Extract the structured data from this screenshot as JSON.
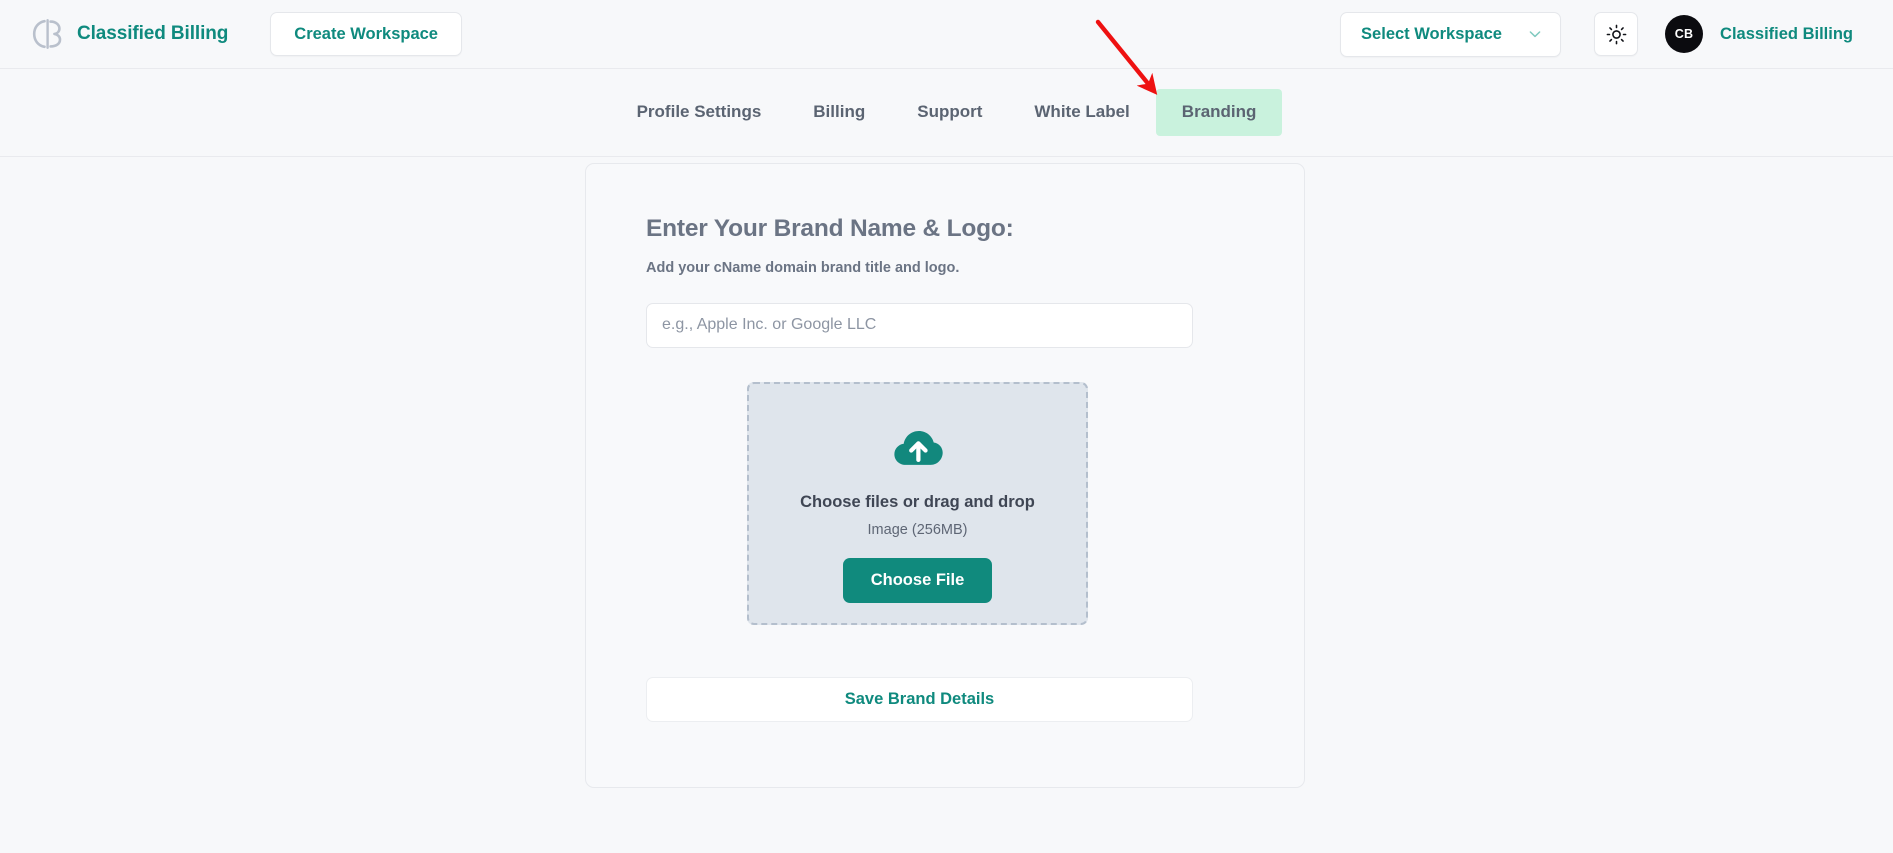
{
  "header": {
    "logo_icon": "cb-monogram-logo-icon",
    "brand_name": "Classified Billing",
    "create_workspace_label": "Create Workspace",
    "workspace_select_label": "Select Workspace",
    "workspace_select_icon": "chevron-down-icon",
    "theme_toggle_icon": "sun-icon",
    "avatar_initials": "CB",
    "account_name": "Classified Billing"
  },
  "tabs": [
    {
      "label": "Profile Settings",
      "active": false
    },
    {
      "label": "Billing",
      "active": false
    },
    {
      "label": "Support",
      "active": false
    },
    {
      "label": "White Label",
      "active": false
    },
    {
      "label": "Branding",
      "active": true
    }
  ],
  "branding_card": {
    "title": "Enter Your Brand Name & Logo:",
    "subtitle": "Add your cName domain brand title and logo.",
    "brand_name_input": {
      "placeholder": "e.g., Apple Inc. or Google LLC",
      "value": ""
    },
    "dropzone": {
      "icon": "cloud-upload-icon",
      "title": "Choose files or drag and drop",
      "hint": "Image (256MB)",
      "choose_file_label": "Choose File"
    },
    "save_label": "Save Brand Details"
  },
  "annotation": {
    "type": "arrow",
    "color": "#ee1111",
    "points_to": "Branding"
  },
  "colors": {
    "brand_teal": "#0f8a7e",
    "button_teal": "#108a7d",
    "active_tab_bg": "#c9f2dd",
    "page_bg": "#f7f8fa",
    "dropzone_bg": "#dfe5ec",
    "annotation_red": "#ee1111"
  }
}
